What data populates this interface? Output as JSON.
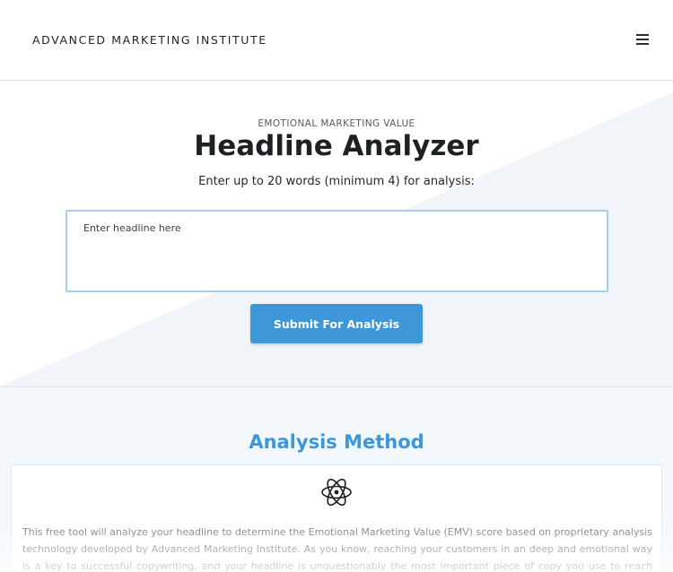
{
  "header": {
    "brand": "ADVANCED MARKETING INSTITUTE",
    "menu_icon": "hamburger-menu-icon"
  },
  "hero": {
    "eyebrow": "EMOTIONAL MARKETING VALUE",
    "title": "Headline Analyzer",
    "instructions": "Enter up to 20 words (minimum 4) for analysis:",
    "input_placeholder": "Enter headline here",
    "input_value": "",
    "submit_label": "Submit For Analysis"
  },
  "method": {
    "title": "Analysis Method",
    "icon": "atom-icon",
    "text": "This free tool will analyze your headline to determine the Emotional Marketing Value (EMV) score based on proprietary analysis technology developed by Advanced Marketing Institute. As you know, reaching your customers in an deep and emotional way is a key to successful copywriting, and your headline is unquestionably the most important piece of copy you use to reach prospects."
  },
  "colors": {
    "accent": "#3d97d8",
    "input_border": "#a9cfe9",
    "section_bg": "#f2f8fc"
  }
}
